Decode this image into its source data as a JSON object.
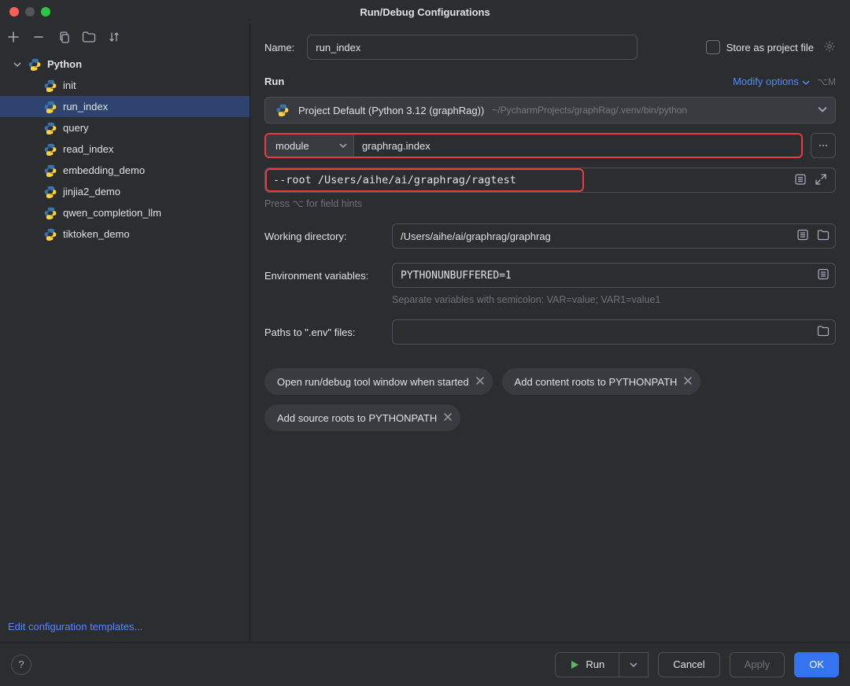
{
  "window": {
    "title": "Run/Debug Configurations"
  },
  "sidebar": {
    "root_label": "Python",
    "items": [
      {
        "label": "init",
        "selected": false
      },
      {
        "label": "run_index",
        "selected": true
      },
      {
        "label": "query",
        "selected": false
      },
      {
        "label": "read_index",
        "selected": false
      },
      {
        "label": "embedding_demo",
        "selected": false
      },
      {
        "label": "jinjia2_demo",
        "selected": false
      },
      {
        "label": "qwen_completion_llm",
        "selected": false
      },
      {
        "label": "tiktoken_demo",
        "selected": false
      }
    ],
    "edit_templates": "Edit configuration templates..."
  },
  "form": {
    "name_label": "Name:",
    "name_value": "run_index",
    "store_label": "Store as project file",
    "run_section": "Run",
    "modify_options": "Modify options",
    "modify_shortcut": "⌥M",
    "interpreter_name": "Project Default (Python 3.12 (graphRag))",
    "interpreter_path": "~/PycharmProjects/graphRag/.venv/bin/python",
    "module_select": "module",
    "module_value": "graphrag.index",
    "args_value": "--root /Users/aihe/ai/graphrag/ragtest",
    "args_hint": "Press ⌥ for field hints",
    "wd_label": "Working directory:",
    "wd_value": "/Users/aihe/ai/graphrag/graphrag",
    "env_label": "Environment variables:",
    "env_value": "PYTHONUNBUFFERED=1",
    "env_hint": "Separate variables with semicolon: VAR=value; VAR1=value1",
    "envfiles_label": "Paths to \".env\" files:",
    "envfiles_value": "",
    "tags": [
      "Open run/debug tool window when started",
      "Add content roots to PYTHONPATH",
      "Add source roots to PYTHONPATH"
    ]
  },
  "footer": {
    "run": "Run",
    "cancel": "Cancel",
    "apply": "Apply",
    "ok": "OK"
  }
}
